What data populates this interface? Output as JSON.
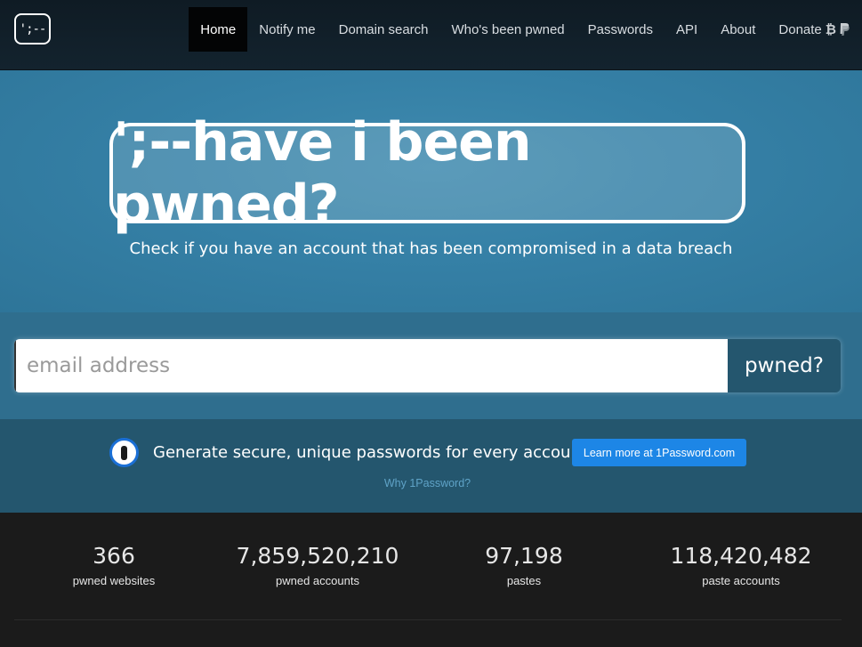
{
  "nav": {
    "logo_text": "';--",
    "items": [
      {
        "label": "Home"
      },
      {
        "label": "Notify me"
      },
      {
        "label": "Domain search"
      },
      {
        "label": "Who's been pwned"
      },
      {
        "label": "Passwords"
      },
      {
        "label": "API"
      },
      {
        "label": "About"
      },
      {
        "label": "Donate"
      }
    ],
    "donate_icons": [
      "bitcoin-icon",
      "paypal-icon"
    ]
  },
  "hero": {
    "title": "';--have i been pwned?",
    "subtitle": "Check if you have an account that has been compromised in a data breach"
  },
  "search": {
    "placeholder": "email address",
    "value": "",
    "button_label": "pwned?"
  },
  "promo": {
    "text": "Generate secure, unique passwords for every account",
    "button_label": "Learn more at 1Password.com",
    "link_label": "Why 1Password?"
  },
  "stats": [
    {
      "value": "366",
      "label": "pwned websites"
    },
    {
      "value": "7,859,520,210",
      "label": "pwned accounts"
    },
    {
      "value": "97,198",
      "label": "pastes"
    },
    {
      "value": "118,420,482",
      "label": "paste accounts"
    }
  ],
  "colors": {
    "hero_bg": "#3580a6",
    "search_band": "#2f6e8e",
    "button_bg": "#24566e",
    "promo_button": "#1d86e6",
    "footer_bg": "#1b1b1b"
  }
}
